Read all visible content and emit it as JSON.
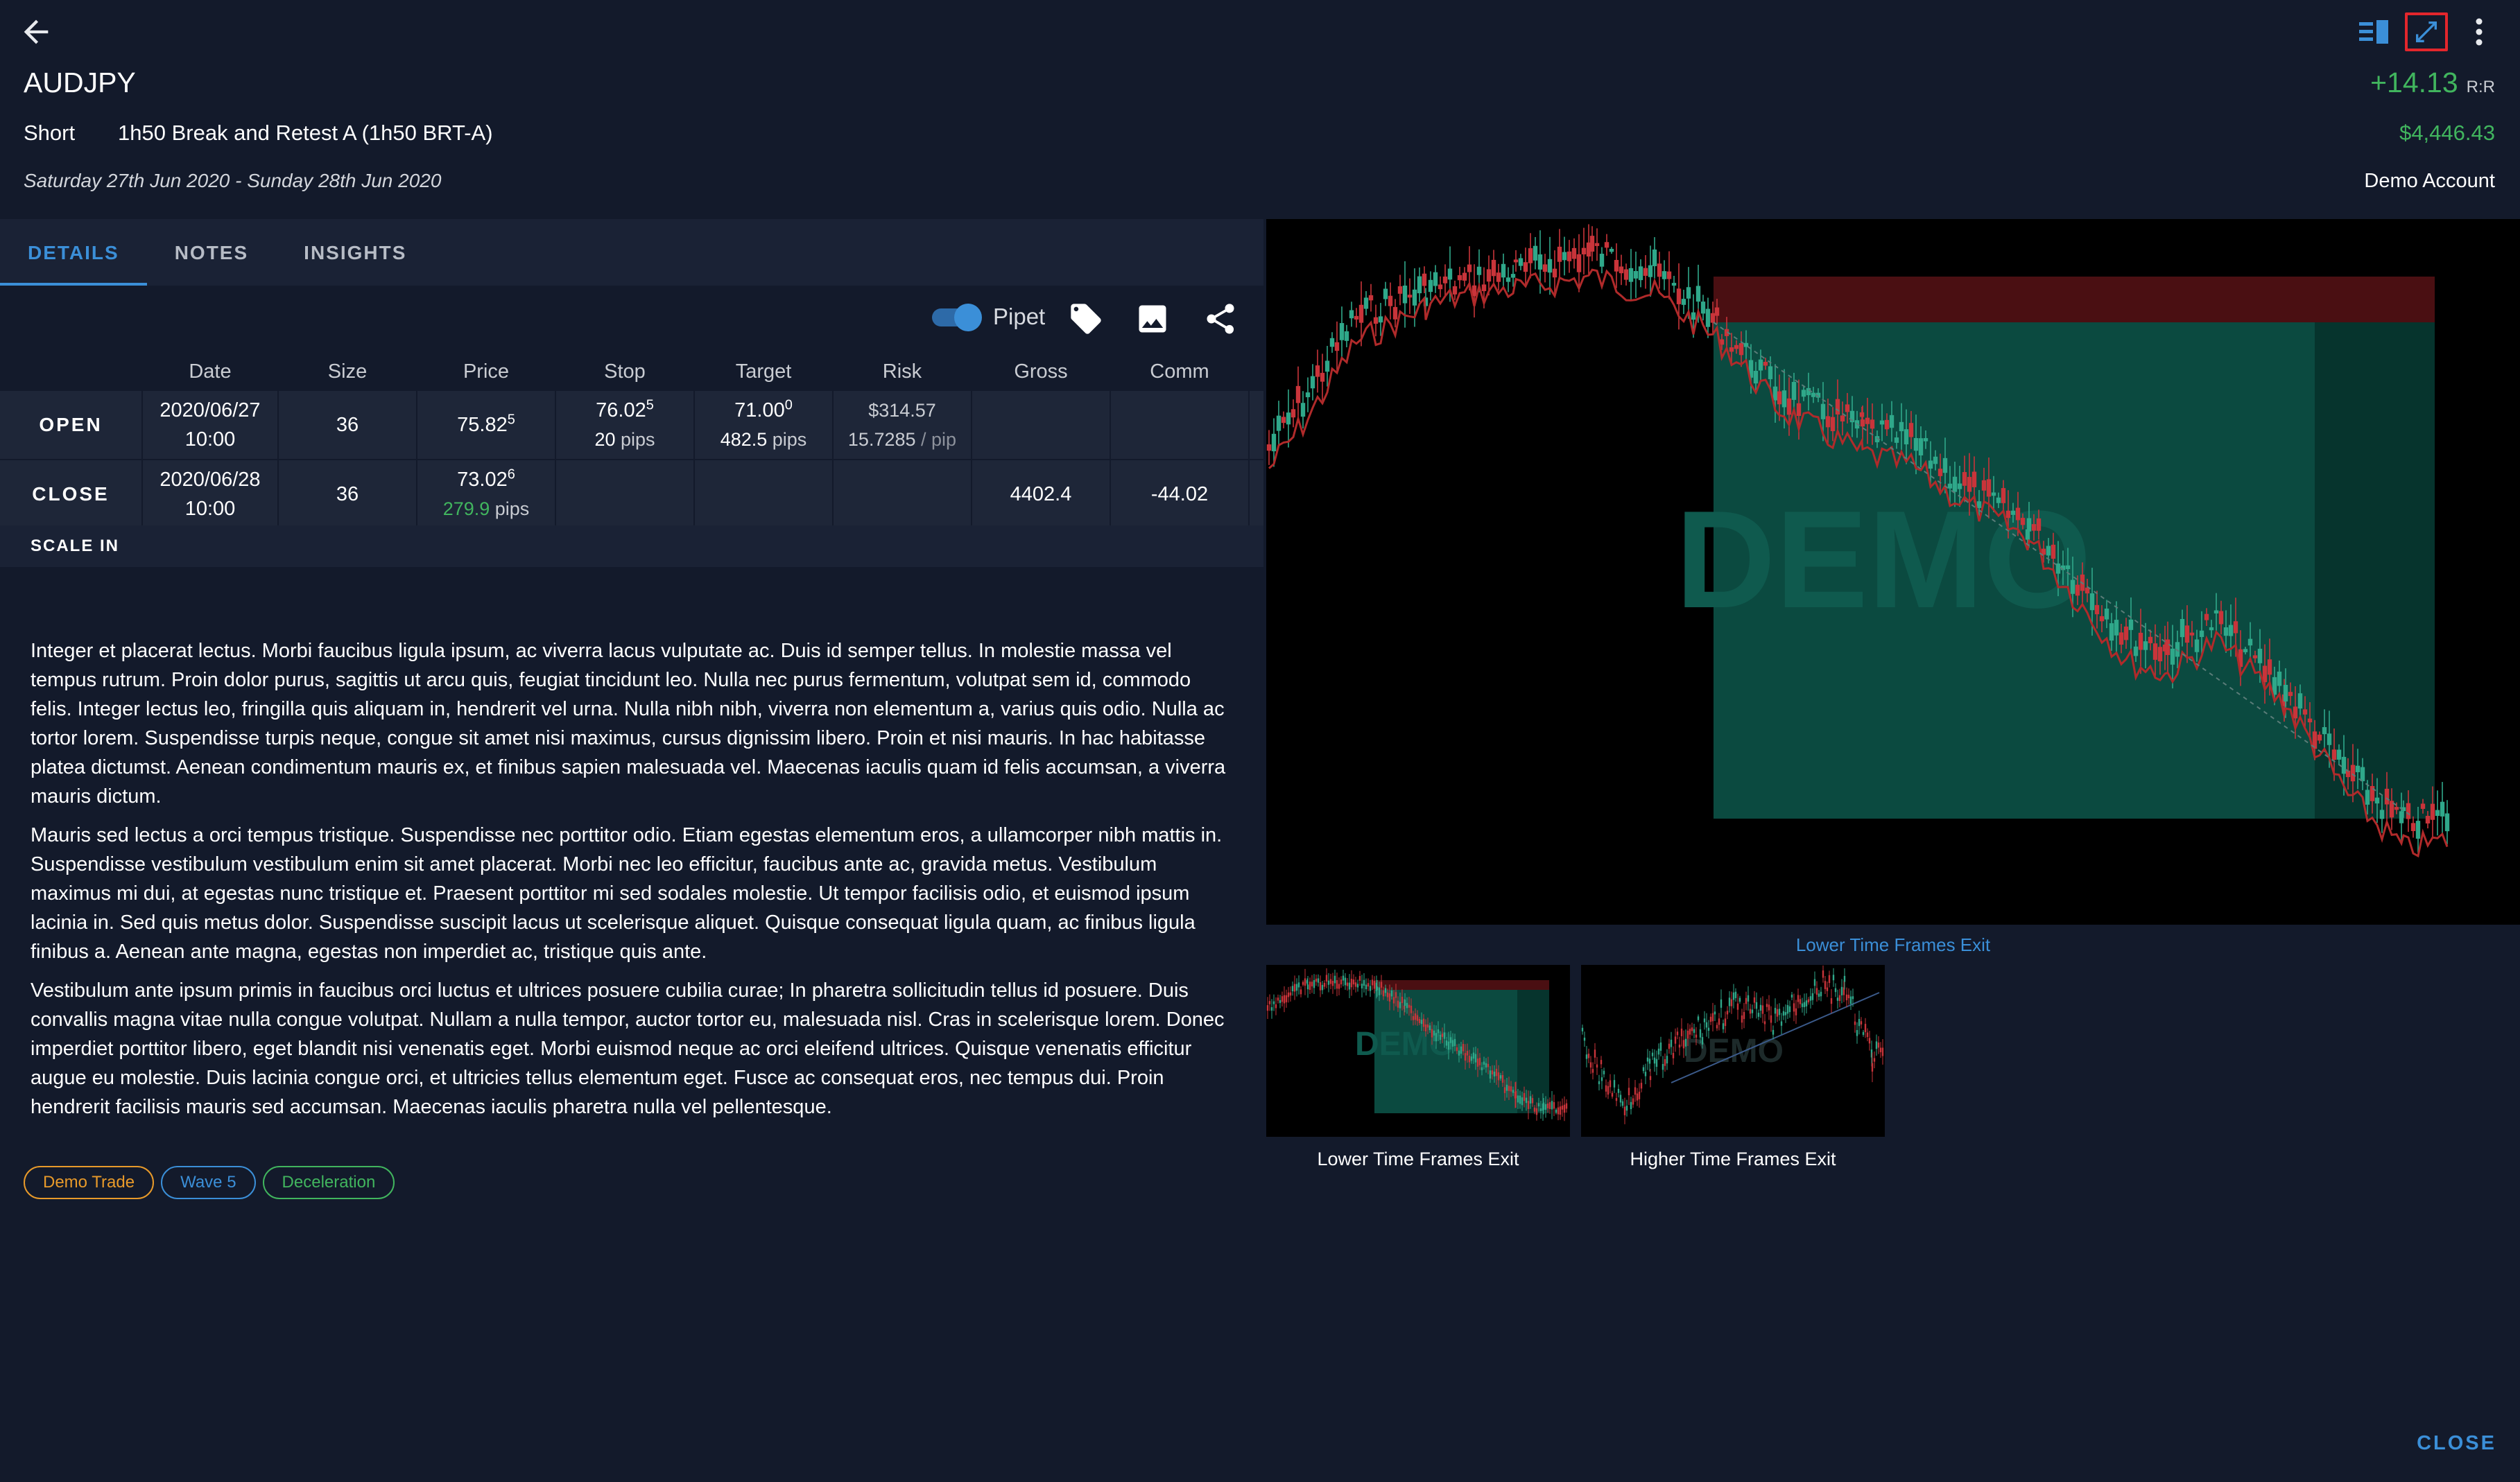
{
  "header": {
    "title": "AUDJPY",
    "direction": "Short",
    "strategy": "1h50 Break and Retest A (1h50 BRT-A)",
    "date_range": "Saturday 27th Jun 2020 - Sunday 28th Jun 2020",
    "rr_value": "+14.13",
    "rr_label": "R:R",
    "pl": "$4,446.43",
    "account": "Demo Account",
    "icons": [
      "back-arrow-icon",
      "list-view-icon",
      "expand-icon",
      "more-vertical-icon"
    ]
  },
  "tabs": [
    {
      "label": "DETAILS",
      "active": true
    },
    {
      "label": "NOTES",
      "active": false
    },
    {
      "label": "INSIGHTS",
      "active": false
    }
  ],
  "toolbar": {
    "pipet_label": "Pipet",
    "pipet_on": true
  },
  "table": {
    "headers": [
      "",
      "Date",
      "Size",
      "Price",
      "Stop",
      "Target",
      "Risk",
      "Gross",
      "Comm"
    ],
    "open": {
      "label": "OPEN",
      "date": "2020/06/27",
      "time": "10:00",
      "size": "36",
      "price_main": "75.82",
      "price_sup": "5",
      "stop_main": "76.02",
      "stop_sup": "5",
      "stop_pips": "20",
      "target_main": "71.00",
      "target_sup": "0",
      "target_pips": "482.5",
      "risk": "$314.57",
      "risk_per_pip": "15.7285",
      "risk_per_pip_unit": "/ pip",
      "pips_unit": "pips",
      "gross": "",
      "comm": ""
    },
    "close": {
      "label": "CLOSE",
      "date": "2020/06/28",
      "time": "10:00",
      "size": "36",
      "price_main": "73.02",
      "price_sup": "6",
      "price_pips": "279.9",
      "pips_unit": "pips",
      "gross": "4402.4",
      "comm": "-44.02"
    },
    "scale_in": "SCALE IN"
  },
  "notes": [
    "Integer et placerat lectus. Morbi faucibus ligula ipsum, ac viverra lacus vulputate ac. Duis id semper tellus. In molestie massa vel tempus rutrum. Proin dolor purus, sagittis ut arcu quis, feugiat tincidunt leo. Nulla nec purus fermentum, volutpat sem id, commodo felis. Integer lectus leo, fringilla quis aliquam in, hendrerit vel urna. Nulla nibh nibh, viverra non elementum a, varius quis odio. Nulla ac tortor lorem. Suspendisse turpis neque, congue sit amet nisi maximus, cursus dignissim libero. Proin et nisi mauris. In hac habitasse platea dictumst. Aenean condimentum mauris ex, et finibus sapien malesuada vel. Maecenas iaculis quam id felis accumsan, a viverra mauris dictum.",
    "Mauris sed lectus a orci tempus tristique. Suspendisse nec porttitor odio. Etiam egestas elementum eros, a ullamcorper nibh mattis in. Suspendisse vestibulum vestibulum enim sit amet placerat. Morbi nec leo efficitur, faucibus ante ac, gravida metus. Vestibulum maximus mi dui, at egestas nunc tristique et. Praesent porttitor mi sed sodales molestie. Ut tempor facilisis odio, et euismod ipsum lacinia in. Sed quis metus dolor. Suspendisse suscipit lacus ut scelerisque aliquet. Quisque consequat ligula quam, ac finibus ligula finibus a. Aenean ante magna, egestas non imperdiet ac, tristique quis ante.",
    "Vestibulum ante ipsum primis in faucibus orci luctus et ultrices posuere cubilia curae; In pharetra sollicitudin tellus id posuere. Duis convallis magna vitae nulla congue volutpat. Nullam a nulla tempor, auctor tortor eu, malesuada nisl. Cras in scelerisque lorem. Donec imperdiet porttitor libero, eget blandit nisi venenatis eget. Morbi euismod neque ac orci eleifend ultrices. Quisque venenatis efficitur augue eu molestie. Duis lacinia congue orci, et ultricies tellus elementum eget. Fusce ac consequat eros, nec tempus dui. Proin hendrerit facilisis mauris sed accumsan. Maecenas iaculis pharetra nulla vel pellentesque."
  ],
  "tags": [
    {
      "label": "Demo Trade",
      "color": "#e89a2a"
    },
    {
      "label": "Wave 5",
      "color": "#3b8fd8"
    },
    {
      "label": "Deceleration",
      "color": "#41b55e"
    }
  ],
  "charts": {
    "watermark": "DEMO",
    "caption": "Lower Time Frames Exit",
    "thumb1_label": "Lower Time Frames Exit",
    "thumb2_label": "Higher Time Frames Exit"
  },
  "footer": {
    "close_label": "CLOSE"
  },
  "colors": {
    "accent": "#3b8fd8",
    "profit": "#41b55e",
    "background": "#131a2b",
    "highlight_border": "#e3262c"
  }
}
